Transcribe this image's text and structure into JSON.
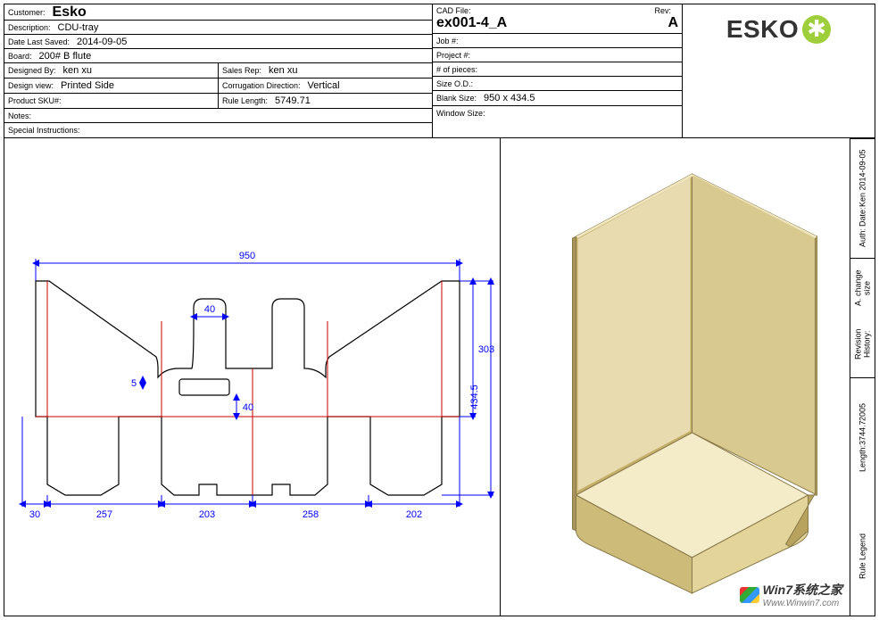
{
  "titleblock": {
    "customer_lbl": "Customer:",
    "customer": "Esko",
    "description_lbl": "Description:",
    "description": "CDU-tray",
    "datesaved_lbl": "Date Last Saved:",
    "datesaved": "2014-09-05",
    "board_lbl": "Board:",
    "board": "200# B flute",
    "designedby_lbl": "Designed By:",
    "designedby": "ken xu",
    "salesrep_lbl": "Sales Rep:",
    "salesrep": "ken xu",
    "designview_lbl": "Design view:",
    "designview": "Printed Side",
    "corrdir_lbl": "Corrugation Direction:",
    "corrdir": "Vertical",
    "sku_lbl": "Product SKU#:",
    "rulelen_lbl": "Rule Length:",
    "rulelen": "5749.71",
    "notes_lbl": "Notes:",
    "special_lbl": "Special Instructions:",
    "cadfile_lbl": "CAD File:",
    "cadfile": "ex001-4_A",
    "rev_lbl": "Rev:",
    "rev": "A",
    "job_lbl": "Job #:",
    "project_lbl": "Project #:",
    "pieces_lbl": "# of pieces:",
    "sizeod_lbl": "Size O.D.:",
    "blanksize_lbl": "Blank Size:",
    "blanksize": "950 x 434.5",
    "windowsize_lbl": "Window Size:",
    "logo_text": "ESKO"
  },
  "dimensions": {
    "width_total": "950",
    "panel1": "30",
    "panel2": "257",
    "panel3": "203",
    "panel4": "258",
    "panel5": "202",
    "height_right": "434.5",
    "height_upper": "303",
    "notch_w": "40",
    "notch_h": "40",
    "tab": "5"
  },
  "sidebar": {
    "auth_lbl": "Auth:",
    "date_lbl": "Date:",
    "auth_val": "Ken 2014-09-05",
    "revhist_lbl": "Revision History:",
    "revhist_val": "A. change size",
    "length_lbl": "Length:",
    "length_a": "3744.7",
    "length_b": "2005",
    "legend_lbl": "Rule Legend"
  },
  "watermark": {
    "line1": "Win7系统之家",
    "line2": "Www.Winwin7.com"
  },
  "colors": {
    "dim": "#0000ff",
    "fold": "#cc0000",
    "box_light": "#e8dbb0",
    "box_dark": "#c9b878",
    "box_edge": "#8a7a4a"
  }
}
